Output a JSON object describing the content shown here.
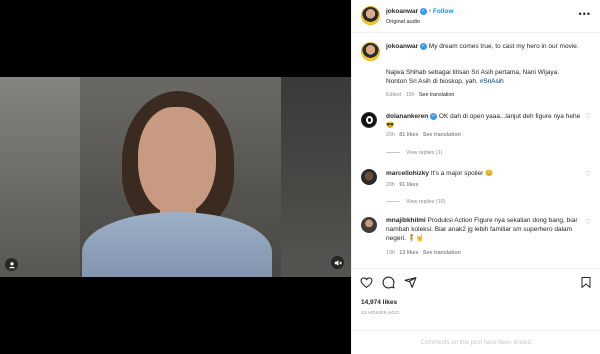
{
  "header": {
    "username": "jokoanwar",
    "follow_label": "Follow",
    "separator": "•",
    "audio": "Original audio",
    "more": "•••"
  },
  "caption": {
    "username": "jokoanwar",
    "text": "My dream comes true, to cast my hero in our movie.",
    "line2": "Najwa Shihab sebagai titisan Sri Asih pertama, Nani Wijaya. Nonton Sri Asih di bioskop, yah.",
    "hashtag": "#SriAsih",
    "meta": "Edited · 19h",
    "see_translation": "See translation"
  },
  "comments": [
    {
      "username": "dolanankeren",
      "text": "OK dah di open yaaa...lanjut deh figure nya hehe 😎",
      "time": "20h",
      "likes": "81 likes",
      "see_translation": "See translation",
      "view_replies": "View replies (1)"
    },
    {
      "username": "marcellohizky",
      "text": "It's a major spoiler 😊",
      "time": "20h",
      "likes": "91 likes",
      "view_replies": "View replies (10)"
    },
    {
      "username": "mnajibkhilmi",
      "text": "Produksi Action Figure nya sekalian dong bang, biar nambah koleksi. Biar anak2 jg lebih familiar sm superhero dalam negeri. 🧍🤘",
      "time": "19h",
      "likes": "13 likes",
      "see_translation": "See translation"
    }
  ],
  "post": {
    "likes": "14,974 likes",
    "date": "23 HOURS AGO",
    "comments_limited": "Comments on this post have been limited."
  },
  "icons": {
    "like": "heart-icon",
    "comment": "comment-icon",
    "share": "send-icon",
    "save": "bookmark-icon",
    "mute": "speaker-muted-icon",
    "tag": "user-tag-icon"
  },
  "colors": {
    "accent": "#0095f6",
    "verified": "#3897f0",
    "text": "#262626",
    "muted": "#8e8e8e"
  }
}
